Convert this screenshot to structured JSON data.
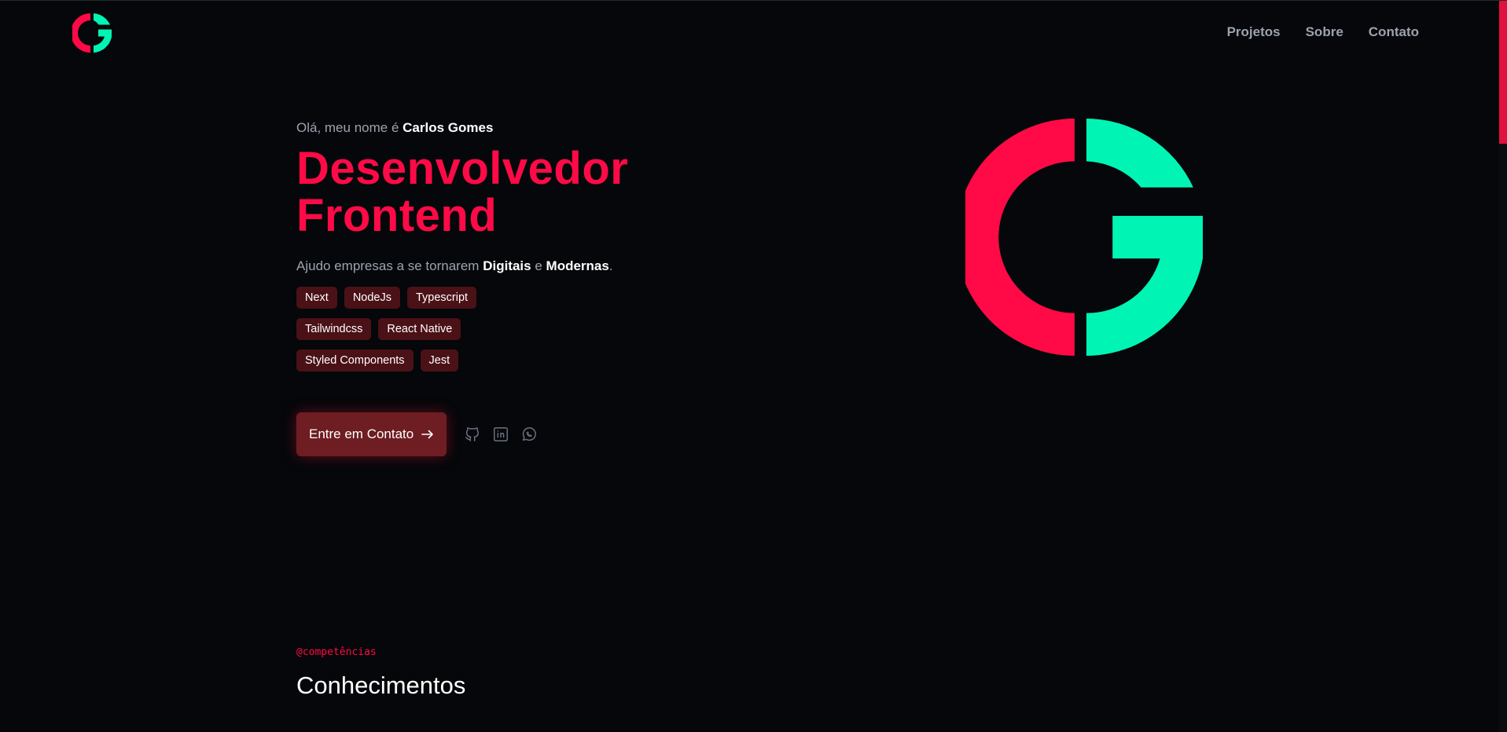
{
  "header": {
    "logo_icon": "cg-logo-icon",
    "nav": [
      {
        "label": "Projetos"
      },
      {
        "label": "Sobre"
      },
      {
        "label": "Contato"
      }
    ]
  },
  "hero": {
    "greeting_prefix": "Olá, meu nome é",
    "name": "Carlos Gomes",
    "title_line1": "Desenvolvedor",
    "title_line2": "Frontend",
    "tagline_prefix": "Ajudo empresas a se tornarem",
    "tagline_word1": "Digitais",
    "tagline_joiner": "e",
    "tagline_word2": "Modernas",
    "tagline_suffix": ".",
    "tags": [
      [
        "Next",
        "NodeJs",
        "Typescript"
      ],
      [
        "Tailwindcss",
        "React Native"
      ],
      [
        "Styled Components",
        "Jest"
      ]
    ],
    "cta_label": "Entre em Contato",
    "cta_icon": "arrow-right-icon",
    "socials": [
      "github-icon",
      "linkedin-icon",
      "whatsapp-icon"
    ]
  },
  "skills": {
    "tag": "@competências",
    "title": "Conhecimentos"
  },
  "colors": {
    "accent_red": "#ff0a47",
    "accent_green": "#00f5b4",
    "background": "#05070a",
    "tag_bg": "#4a1116",
    "button_bg": "#6e1d22"
  }
}
